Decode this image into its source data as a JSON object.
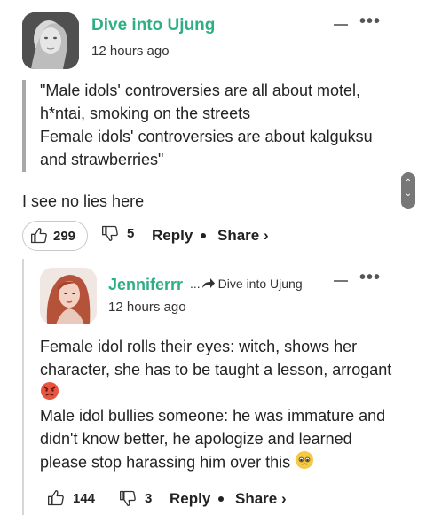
{
  "comments": [
    {
      "username": "Dive into Ujung",
      "time": "12 hours ago",
      "quote_lines": [
        "\"Male idols' controversies are all about motel,",
        "h*ntai, smoking on the streets",
        "Female idols' controversies are about kalguksu",
        "and strawberries\""
      ],
      "body": "I see no lies here",
      "likes": "299",
      "dislikes": "5",
      "reply_label": "Reply",
      "share_label": "Share ›"
    },
    {
      "username": "Jenniferrr",
      "reply_to_prefix": "...",
      "reply_to": "Dive into Ujung",
      "time": "12 hours ago",
      "body_lines": [
        "Female idol rolls their eyes: witch, shows her",
        "character, she has to be taught a lesson, arrogant",
        "Male idol bullies someone: he was immature and",
        "didn't know better, he apologize and learned",
        "please stop harassing him over this"
      ],
      "likes": "144",
      "dislikes": "3",
      "reply_label": "Reply",
      "share_label": "Share ›"
    }
  ],
  "colors": {
    "username": "#2fae86",
    "text": "#222222",
    "quote_bar": "#a8a8a8"
  },
  "icons": [
    "collapse-icon",
    "more-dots-icon",
    "thumbs-up-icon",
    "thumbs-down-icon",
    "reply-arrow-icon",
    "angry-face-emoji",
    "pleading-face-emoji"
  ]
}
